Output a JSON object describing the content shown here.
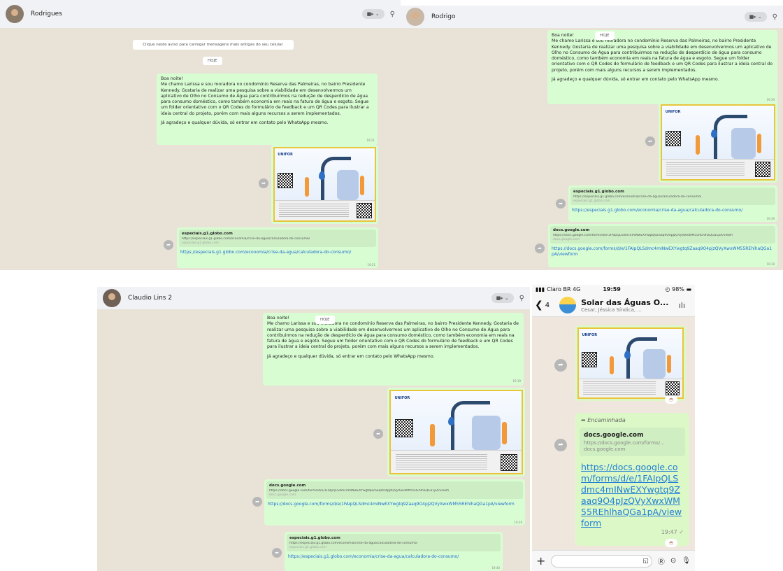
{
  "message": {
    "greeting": "Boa noite!",
    "para1": "Me chamo Larissa e sou moradora no condomínio Reserva das Palmeiras, no bairro Presidente Kennedy. Gostaria de realizar uma pesquisa sobre a viabilidade em desenvolvermos um aplicativo de Olho no Consumo de Água para contribuirmos na redução de desperdício de água para consumo doméstico, como também economia em reais na fatura de água e esgoto. Segue um folder orientativo com o QR Codes do formulário de feedback e um  QR Codes para ilustrar a ideia central do projeto, porém com mais alguns recursos a serem implementados.",
    "para2": "Já agradeço e qualquer dúvida, só entrar em contato pelo WhatsApp mesmo."
  },
  "links": {
    "g1": {
      "title": "especiais.g1.globo.com",
      "url": "https://especiais.g1.globo.com/economia/crise-da-agua/calculadora-do-consumo/",
      "domain": "especiais.g1.globo.com",
      "href": "https://especiais.g1.globo.com/economia/crise-da-agua/calculadora-do-consumo/"
    },
    "docs": {
      "title": "docs.google.com",
      "url": "https://docs.google.com/forms/d/e/1FAIpQLSdmc4mINwEXYwgtq9Zaaq9O4pJzQVyXwxWM55REhlhaQGa1pA/viewfi",
      "domain": "docs.google.com",
      "href": "https://docs.google.com/forms/d/e/1FAIpQLSdmc4mINwEXYwgtq9Zaaq9O4pJzQVyXwxWM55REhlhaQGa1pA/viewform"
    }
  },
  "poster": {
    "logo": "UNIFOR"
  },
  "today_label": "HOJE",
  "panel1": {
    "contact": "Rodrigues",
    "notice": "Clique neste aviso para carregar mensagens mais antigas do seu celular.",
    "time_msg": "19:21",
    "time_link": "19:21"
  },
  "panel2": {
    "contact": "Rodrigo",
    "time_msg": "19:39",
    "time_link1": "19:39",
    "time_link2": "19:39"
  },
  "panel3": {
    "contact": "Claudio Lins 2",
    "time_msg": "19:39",
    "time_link1": "19:39",
    "time_link2": "19:40"
  },
  "phone": {
    "carrier": "Claro BR  4G",
    "time": "19:59",
    "battery": "98%",
    "back_count": "4",
    "group_name": "Solar das Águas O...",
    "group_members": "Cesar, Jéssica Síndica, ...",
    "forwarded": "Encaminhada",
    "card_title": "docs.google.com",
    "card_url": "https://docs.google.com/forms/...",
    "card_domain": "docs.google.com",
    "link_text": "https://docs.google.com/forms/d/e/1FAIpQLSdmc4mINwEXYwgtq9Zaaq9O4pJzQVyXwxWM55REhlhaQGa1pA/viewform",
    "msg_time": "19:47"
  }
}
